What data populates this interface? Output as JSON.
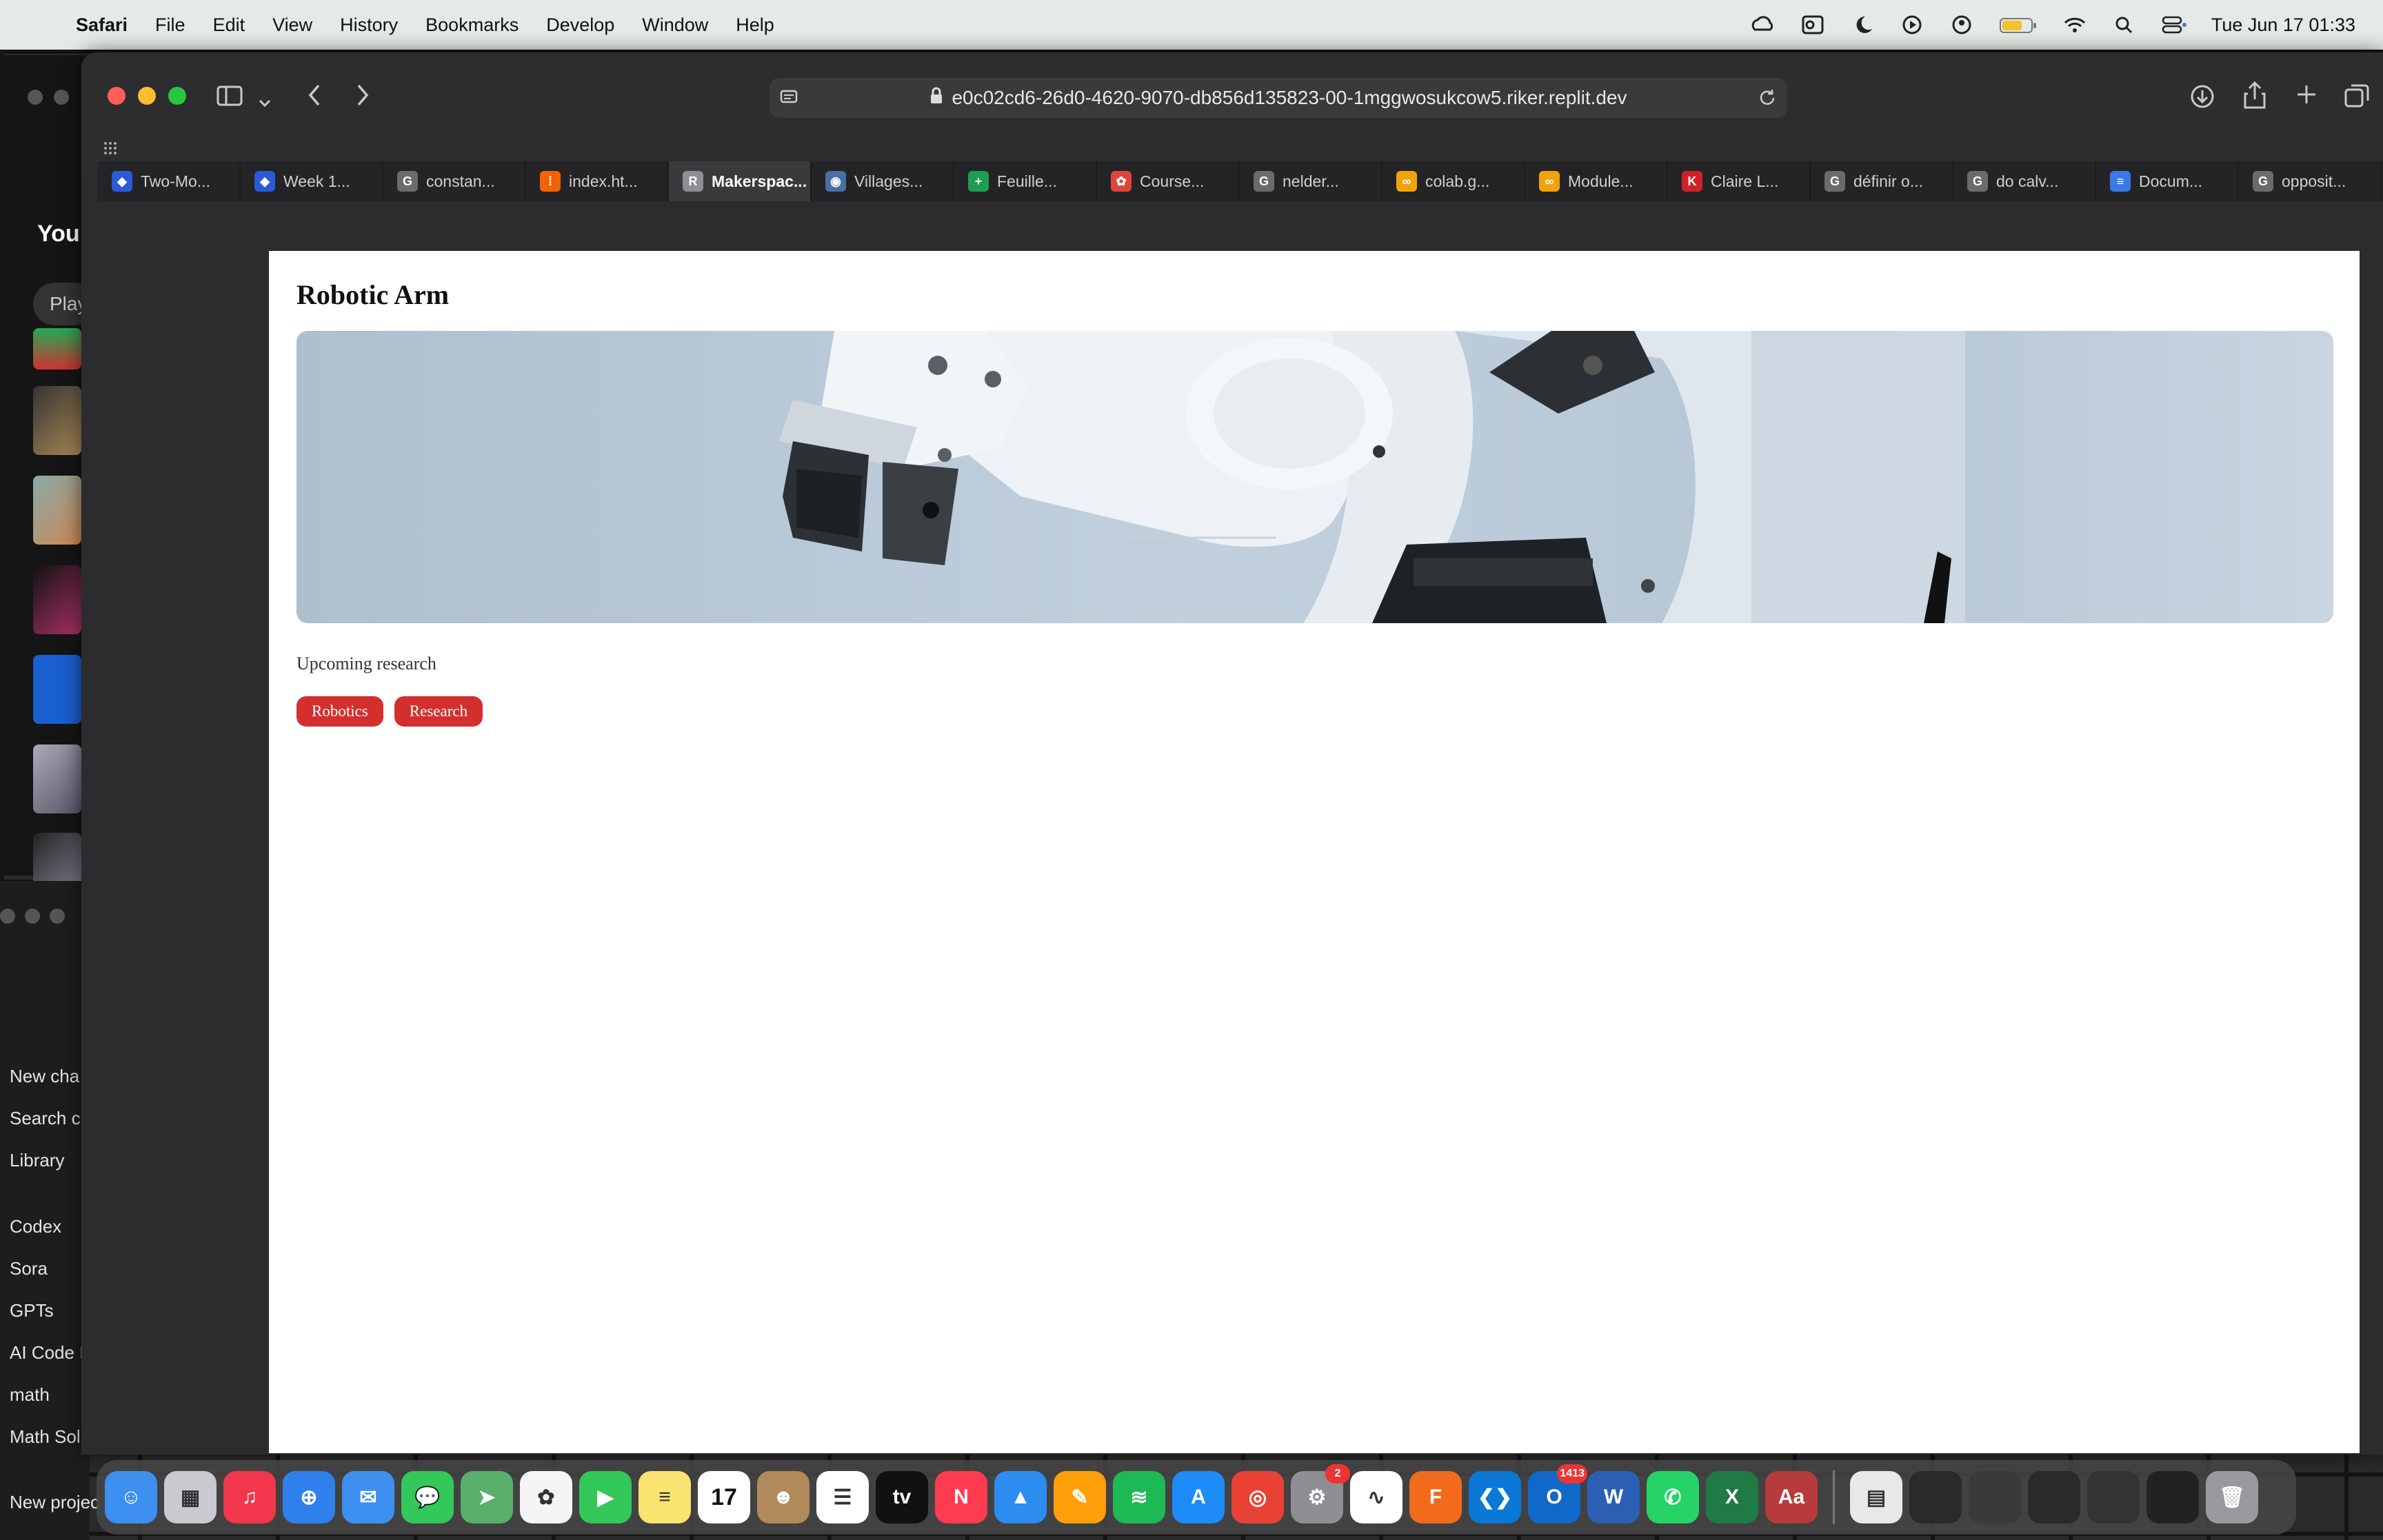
{
  "menubar": {
    "app": "Safari",
    "items": [
      "File",
      "Edit",
      "View",
      "History",
      "Bookmarks",
      "Develop",
      "Window",
      "Help"
    ],
    "clock": "Tue Jun 17  01:33"
  },
  "left_window": {
    "title": "Your",
    "pill": "Play"
  },
  "left_sidebar": {
    "items": [
      "New cha",
      "Search c",
      "Library",
      "Codex",
      "Sora",
      "GPTs",
      "AI Code I",
      "math",
      "Math Sol",
      "New projec"
    ]
  },
  "browser": {
    "url": "e0c02cd6-26d0-4620-9070-db856d135823-00-1mggwosukcow5.riker.replit.dev",
    "tabs": [
      {
        "label": "Two-Mo...",
        "icon": "shield-tab-icon",
        "color": "#2a5bd7",
        "glyph": "◆"
      },
      {
        "label": "Week 1...",
        "icon": "shield-tab-icon",
        "color": "#2a5bd7",
        "glyph": "◆"
      },
      {
        "label": "constan...",
        "icon": "g-tab-icon",
        "color": "#6b6b6b",
        "glyph": "G"
      },
      {
        "label": "index.ht...",
        "icon": "replit-tab-icon",
        "color": "#f26207",
        "glyph": "⁞"
      },
      {
        "label": "Makerspac...",
        "icon": "r-tab-icon",
        "color": "#8e8e93",
        "glyph": "R"
      },
      {
        "label": "Villages...",
        "icon": "globe-tab-icon",
        "color": "#4a6fa5",
        "glyph": "◉"
      },
      {
        "label": "Feuille...",
        "icon": "sheets-tab-icon",
        "color": "#1e9e52",
        "glyph": "+"
      },
      {
        "label": "Course...",
        "icon": "coursera-tab-icon",
        "color": "#e0453a",
        "glyph": "✿"
      },
      {
        "label": "nelder...",
        "icon": "g-tab-icon",
        "color": "#6b6b6b",
        "glyph": "G"
      },
      {
        "label": "colab.g...",
        "icon": "colab-tab-icon",
        "color": "#f2a20c",
        "glyph": "∞"
      },
      {
        "label": "Module...",
        "icon": "colab-tab-icon",
        "color": "#f2a20c",
        "glyph": "∞"
      },
      {
        "label": "Claire L...",
        "icon": "k-tab-icon",
        "color": "#d1202a",
        "glyph": "K"
      },
      {
        "label": "définir o...",
        "icon": "g-tab-icon",
        "color": "#6b6b6b",
        "glyph": "G"
      },
      {
        "label": "do calv...",
        "icon": "g-tab-icon",
        "color": "#6b6b6b",
        "glyph": "G"
      },
      {
        "label": "Docum...",
        "icon": "docs-tab-icon",
        "color": "#3b78e7",
        "glyph": "≡"
      },
      {
        "label": "opposit...",
        "icon": "g-tab-icon",
        "color": "#6b6b6b",
        "glyph": "G"
      }
    ],
    "active_tab_index": 4
  },
  "page": {
    "title": "Robotic Arm",
    "description": "Upcoming research",
    "tags": [
      "Robotics",
      "Research"
    ],
    "accent": "#d32f2f"
  },
  "dock": {
    "apps": [
      {
        "name": "finder",
        "color": "#3d8ff0",
        "glyph": "☺"
      },
      {
        "name": "launchpad",
        "color": "#c9c9cf",
        "glyph": "▦"
      },
      {
        "name": "music",
        "color": "#f2364c",
        "glyph": "♫"
      },
      {
        "name": "safari",
        "color": "#2f80ed",
        "glyph": "⊕"
      },
      {
        "name": "mail",
        "color": "#3d8ff0",
        "glyph": "✉"
      },
      {
        "name": "messages",
        "color": "#34c759",
        "glyph": "💬"
      },
      {
        "name": "maps",
        "color": "#58b06a",
        "glyph": "➤"
      },
      {
        "name": "photos",
        "color": "#f5f5f5",
        "glyph": "✿"
      },
      {
        "name": "facetime",
        "color": "#34c759",
        "glyph": "▶"
      },
      {
        "name": "notes",
        "color": "#fbe36f",
        "glyph": "≡"
      },
      {
        "name": "calendar",
        "color": "#ffffff",
        "glyph": "17"
      },
      {
        "name": "contacts",
        "color": "#b08a5a",
        "glyph": "☻"
      },
      {
        "name": "reminders",
        "color": "#ffffff",
        "glyph": "☰"
      },
      {
        "name": "tv",
        "color": "#111111",
        "glyph": "tv"
      },
      {
        "name": "news",
        "color": "#ff3b52",
        "glyph": "N"
      },
      {
        "name": "keynote",
        "color": "#2d8cf0",
        "glyph": "▲"
      },
      {
        "name": "pages",
        "color": "#ff9f0a",
        "glyph": "✎"
      },
      {
        "name": "spotify",
        "color": "#1db954",
        "glyph": "≋"
      },
      {
        "name": "app-store",
        "color": "#1d8cf8",
        "glyph": "A"
      },
      {
        "name": "chrome",
        "color": "#e94235",
        "glyph": "◎"
      },
      {
        "name": "system-settings",
        "color": "#8e8e93",
        "glyph": "⚙",
        "badge": "2"
      },
      {
        "name": "freeform",
        "color": "#ffffff",
        "glyph": "∿"
      },
      {
        "name": "fusion",
        "color": "#f26b1d",
        "glyph": "F"
      },
      {
        "name": "vscode",
        "color": "#0a78d4",
        "glyph": "❮❯"
      },
      {
        "name": "outlook",
        "color": "#1068c9",
        "glyph": "O",
        "badge": "1413"
      },
      {
        "name": "word",
        "color": "#2b5fb4",
        "glyph": "W"
      },
      {
        "name": "whatsapp",
        "color": "#25d366",
        "glyph": "✆"
      },
      {
        "name": "excel",
        "color": "#1f7a46",
        "glyph": "X"
      },
      {
        "name": "dictionary",
        "color": "#b83b3b",
        "glyph": "Aa"
      }
    ],
    "recents": [
      {
        "name": "document",
        "color": "#e8e8e8",
        "glyph": "▤"
      },
      {
        "name": "window-preview-1",
        "color": "#2a2a2a",
        "glyph": ""
      },
      {
        "name": "window-preview-2",
        "color": "#3a3a3a",
        "glyph": ""
      },
      {
        "name": "window-preview-3",
        "color": "#2a2a2a",
        "glyph": ""
      },
      {
        "name": "window-preview-4",
        "color": "#333333",
        "glyph": ""
      },
      {
        "name": "window-preview-5",
        "color": "#222222",
        "glyph": ""
      },
      {
        "name": "trash",
        "color": "#9a9a9e",
        "glyph": "🗑"
      }
    ]
  }
}
